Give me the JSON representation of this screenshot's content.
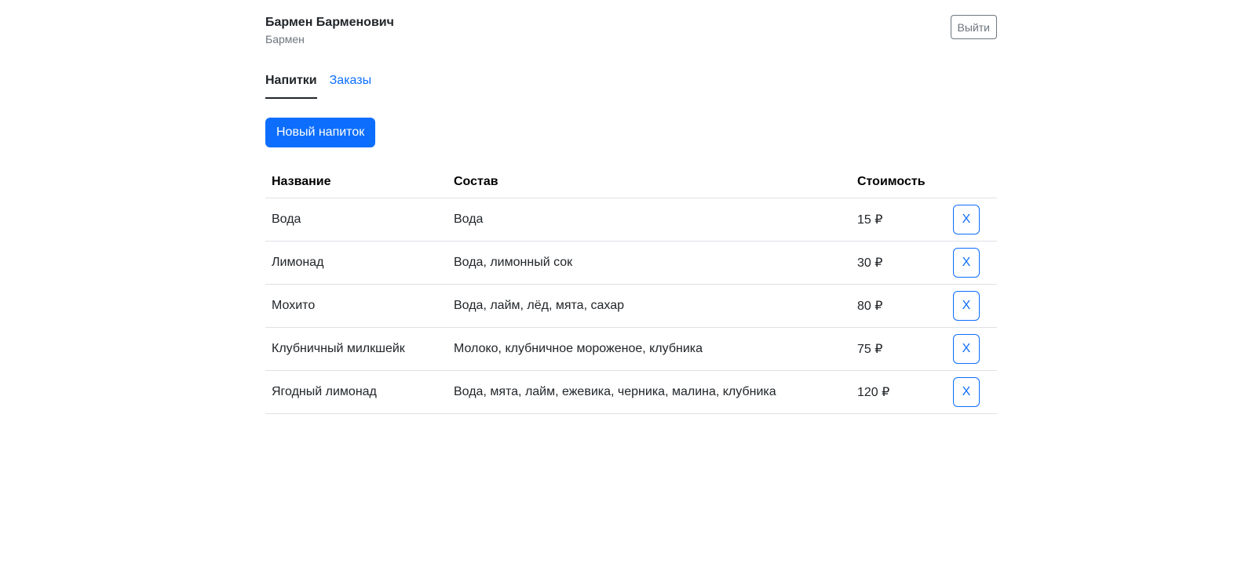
{
  "user": {
    "name": "Бармен Барменович",
    "role": "Бармен"
  },
  "header": {
    "logout_label": "Выйти"
  },
  "tabs": [
    {
      "label": "Напитки",
      "active": true
    },
    {
      "label": "Заказы",
      "active": false
    }
  ],
  "toolbar": {
    "new_drink_label": "Новый напиток"
  },
  "table": {
    "columns": [
      "Название",
      "Состав",
      "Стоимость",
      ""
    ],
    "rows": [
      {
        "name": "Вода",
        "composition": "Вода",
        "price": "15 ₽",
        "delete_label": "X"
      },
      {
        "name": "Лимонад",
        "composition": "Вода, лимонный сок",
        "price": "30 ₽",
        "delete_label": "X"
      },
      {
        "name": "Мохито",
        "composition": "Вода, лайм, лёд, мята, сахар",
        "price": "80 ₽",
        "delete_label": "X"
      },
      {
        "name": "Клубничный милкшейк",
        "composition": "Молоко, клубничное мороженое, клубника",
        "price": "75 ₽",
        "delete_label": "X"
      },
      {
        "name": "Ягодный лимонад",
        "composition": "Вода, мята, лайм, ежевика, черника, малина, клубника",
        "price": "120 ₽",
        "delete_label": "X"
      }
    ]
  },
  "colors": {
    "primary": "#0d6efd",
    "secondary": "#6c757d",
    "text": "#212529",
    "border": "#dee2e6"
  }
}
